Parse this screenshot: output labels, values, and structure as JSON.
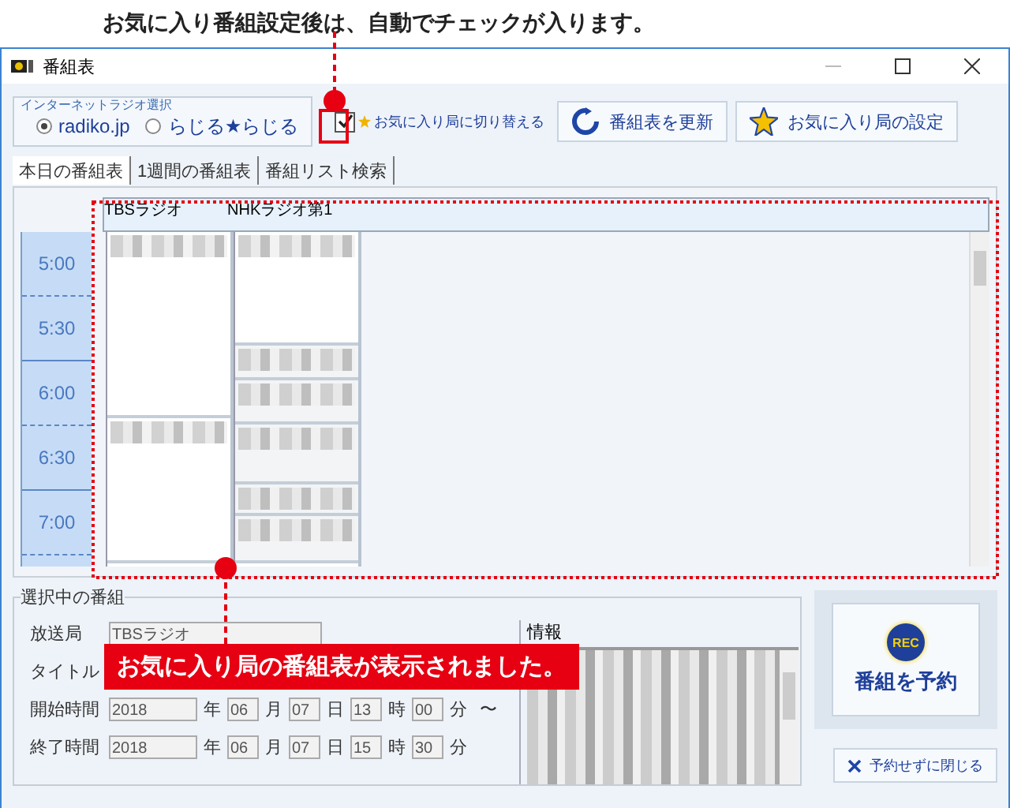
{
  "annotations": [
    {
      "kind": "top",
      "text": "お気に入り番組設定後は、自動でチェックが入ります。"
    },
    {
      "kind": "callout",
      "text": "お気に入り局の番組表が表示されました。"
    }
  ],
  "window": {
    "title": "番組表"
  },
  "radio_group": {
    "legend": "インターネットラジオ選択",
    "options": [
      {
        "label": "radiko.jp",
        "selected": true
      },
      {
        "label": "らじる★らじる",
        "selected": false
      }
    ]
  },
  "favorite_toggle": {
    "label": "お気に入り局に切り替える",
    "checked": true
  },
  "toolbar_buttons": [
    {
      "kind": "refresh",
      "label": "番組表を更新"
    },
    {
      "kind": "star",
      "label": "お気に入り局の設定"
    }
  ],
  "tabs": [
    {
      "label": "本日の番組表",
      "selected": true
    },
    {
      "label": "1週間の番組表",
      "selected": false
    },
    {
      "label": "番組リスト検索",
      "selected": false
    }
  ],
  "schedule": {
    "stations": [
      "TBSラジオ",
      "NHKラジオ第1"
    ],
    "times": [
      "5:00",
      "5:30",
      "6:00",
      "6:30",
      "7:00"
    ]
  },
  "selected_program": {
    "legend": "選択中の番組",
    "station_label": "放送局",
    "station_value": "TBSラジオ",
    "title_label": "タイトル",
    "rows": [
      {
        "label": "開始時間",
        "year": "2018",
        "month": "06",
        "day": "07",
        "hour": "13",
        "minute": "00",
        "units": [
          "年",
          "月",
          "日",
          "時",
          "分"
        ],
        "suffix": "〜"
      },
      {
        "label": "終了時間",
        "year": "2018",
        "month": "06",
        "day": "07",
        "hour": "15",
        "minute": "30",
        "units": [
          "年",
          "月",
          "日",
          "時",
          "分"
        ]
      }
    ]
  },
  "info": {
    "label": "情報"
  },
  "reserve_button": {
    "badge": "REC",
    "label": "番組を予約"
  },
  "close_button": {
    "label": "予約せずに閉じる"
  }
}
